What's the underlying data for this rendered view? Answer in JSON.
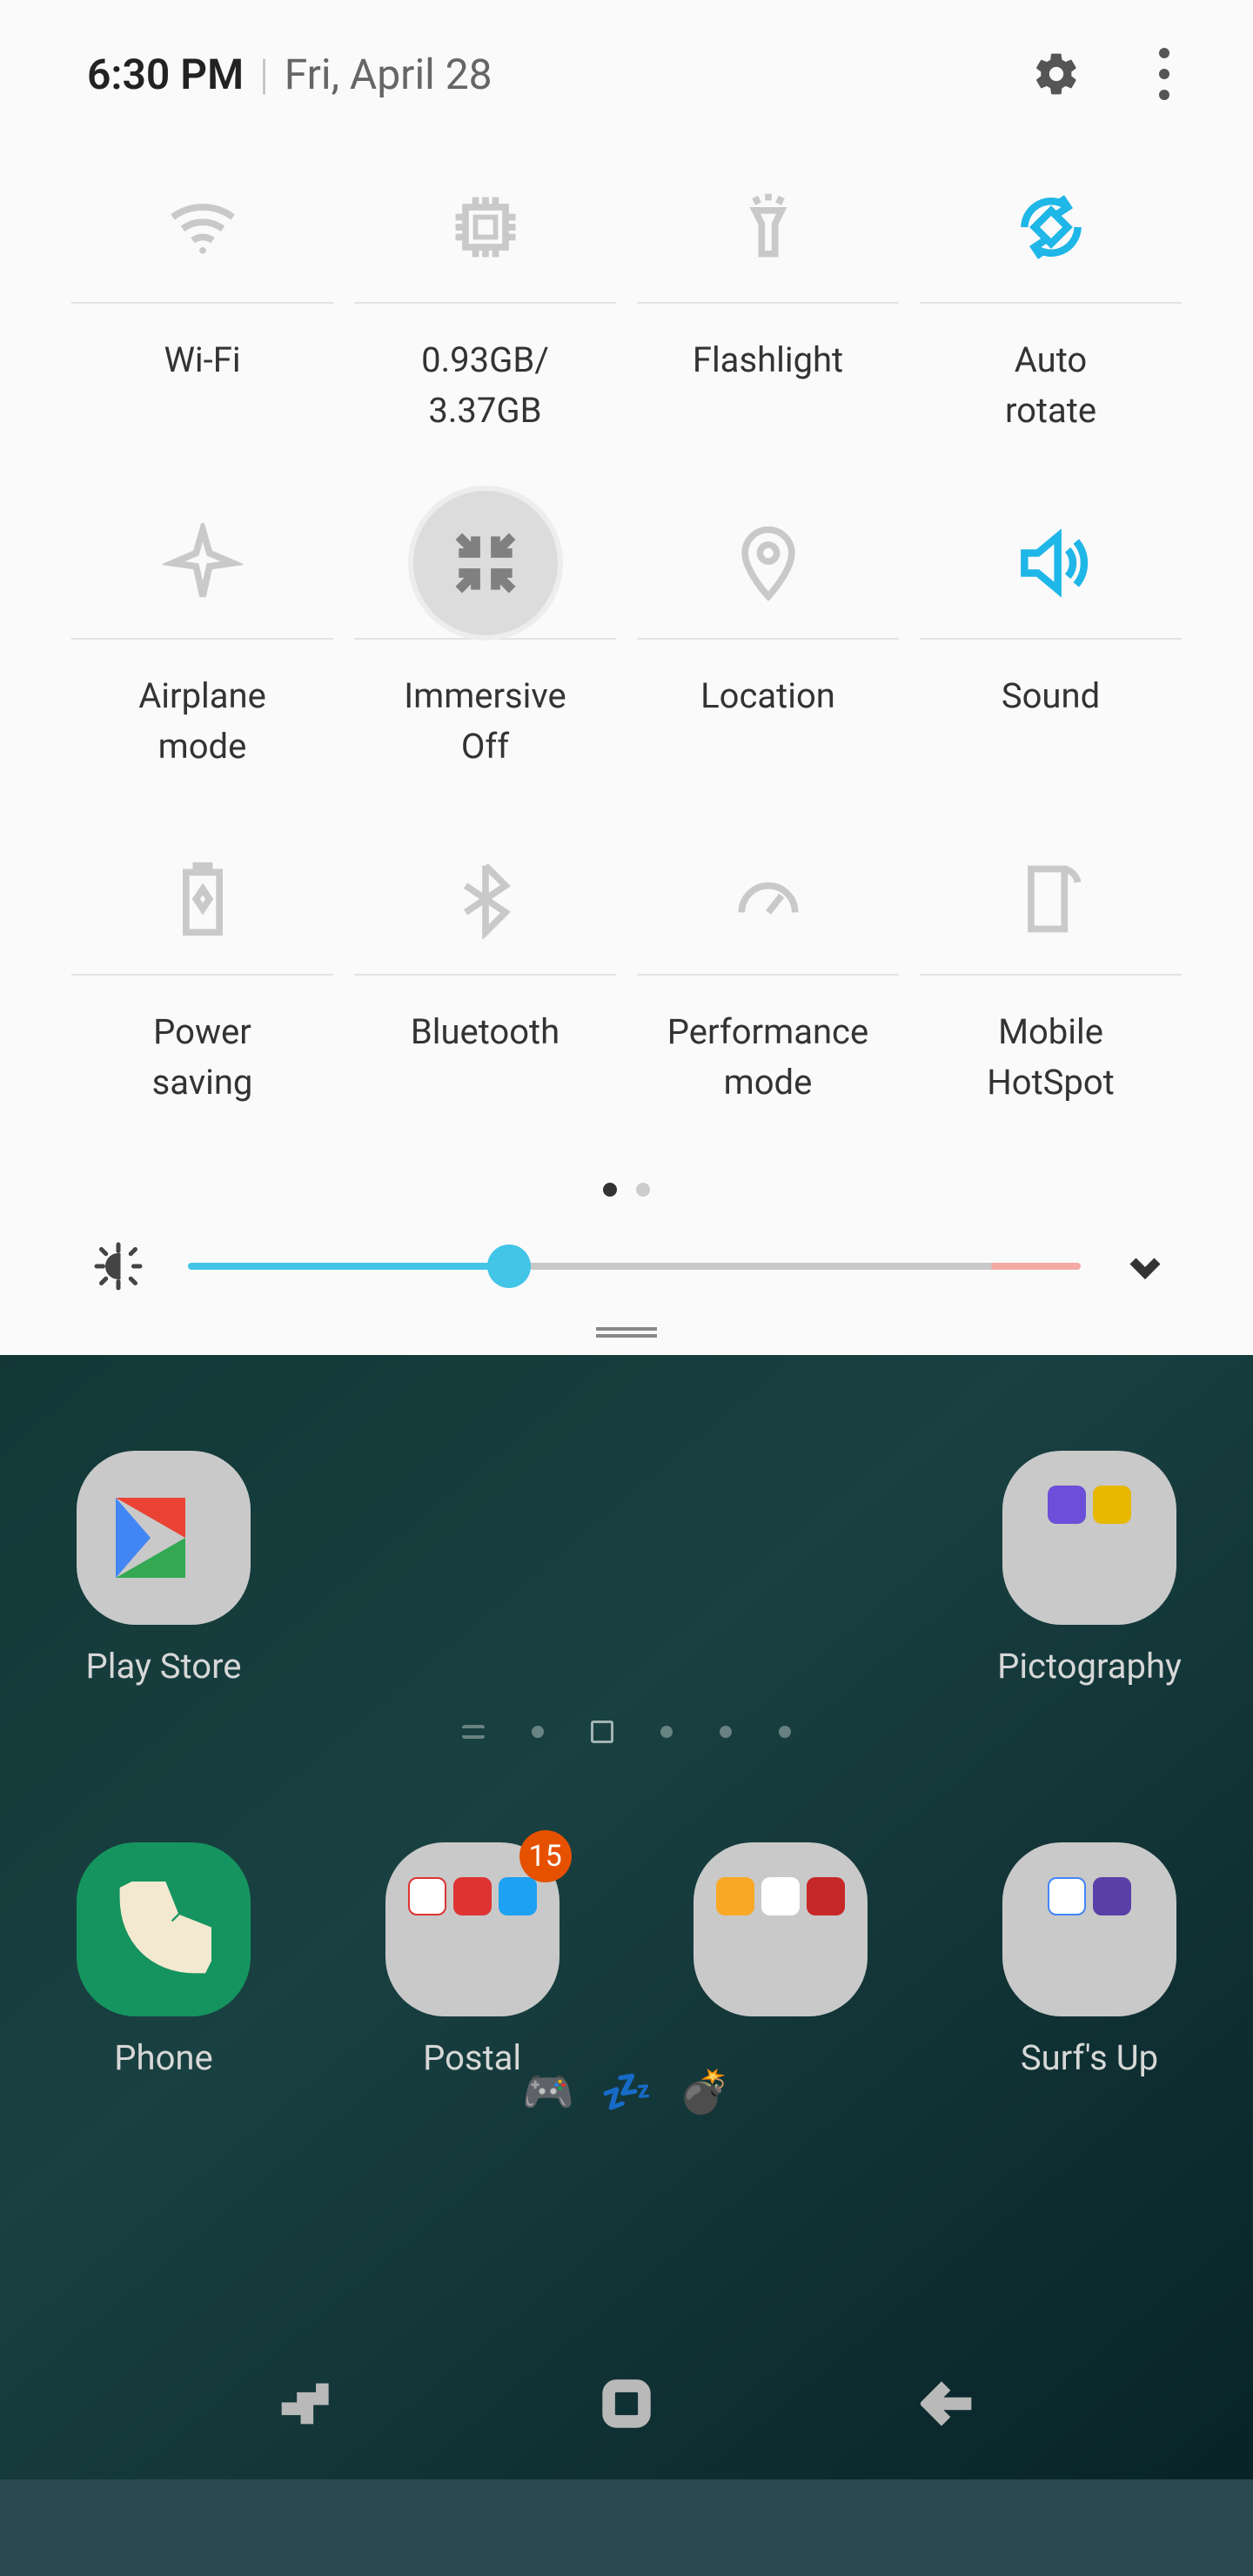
{
  "header": {
    "time": "6:30 PM",
    "date": "Fri, April 28"
  },
  "tiles": [
    {
      "id": "wifi",
      "label": "Wi-Fi",
      "active": false
    },
    {
      "id": "ram",
      "label": "0.93GB/\n3.37GB",
      "active": false
    },
    {
      "id": "flashlight",
      "label": "Flashlight",
      "active": false
    },
    {
      "id": "autorotate",
      "label": "Auto\nrotate",
      "active": true
    },
    {
      "id": "airplane",
      "label": "Airplane\nmode",
      "active": false
    },
    {
      "id": "immersive",
      "label": "Immersive\nOff",
      "active": false
    },
    {
      "id": "location",
      "label": "Location",
      "active": false
    },
    {
      "id": "sound",
      "label": "Sound",
      "active": true
    },
    {
      "id": "powersave",
      "label": "Power\nsaving",
      "active": false
    },
    {
      "id": "bluetooth",
      "label": "Bluetooth",
      "active": false
    },
    {
      "id": "performance",
      "label": "Performance\nmode",
      "active": false
    },
    {
      "id": "hotspot",
      "label": "Mobile\nHotSpot",
      "active": false
    }
  ],
  "pager": {
    "pages": 2,
    "current": 0
  },
  "brightness": {
    "percent": 36
  },
  "home": {
    "row1": [
      {
        "id": "playstore",
        "label": "Play Store"
      },
      {
        "id": "pictography",
        "label": "Pictography"
      }
    ],
    "dock": [
      {
        "id": "phone",
        "label": "Phone"
      },
      {
        "id": "postal",
        "label": "Postal",
        "badge": "15"
      },
      {
        "id": "group1",
        "label": ""
      },
      {
        "id": "surfsup",
        "label": "Surf's Up"
      }
    ],
    "status_emoji": "💤"
  }
}
